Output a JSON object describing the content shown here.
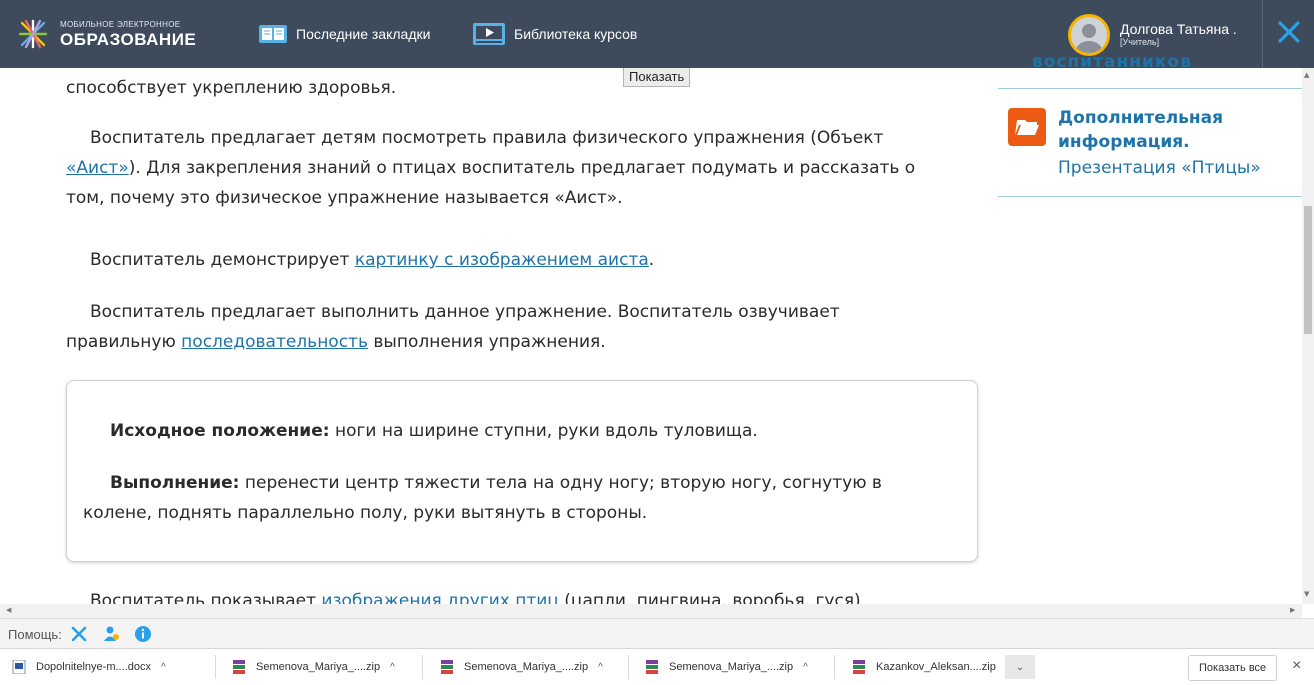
{
  "header": {
    "logo_small": "МОБИЛЬНОЕ ЭЛЕКТРОННОЕ",
    "logo_big": "ОБРАЗОВАНИЕ",
    "nav": [
      {
        "label": "Последние закладки",
        "icon": "bookmarks-icon"
      },
      {
        "label": "Библиотека курсов",
        "icon": "video-library-icon"
      }
    ],
    "user_name": "Долгова Татьяна .",
    "user_role": "[Учитель]",
    "colors": {
      "bar": "#3d4b5c",
      "accent": "#1e73a8",
      "avatar_ring": "#f5b400",
      "close": "#2aa0e8"
    }
  },
  "tooltip": "Показать",
  "content": {
    "p1": "способствует укреплению здоровья.",
    "p2_a": "Воспитатель предлагает детям посмотреть правила физического упражнения (Объект ",
    "p2_link": "«Аист»",
    "p2_b": "). Для закрепления знаний о птицах воспитатель предлагает подумать и рассказать о том, почему это физическое упражнение называется «Аист».",
    "p3_a": "Воспитатель демонстрирует ",
    "p3_link": "картинку с изображением аиста",
    "p3_b": ".",
    "p4_a": "Воспитатель предлагает выполнить данное упражнение. Воспитатель озвучивает правильную ",
    "p4_link": "последовательность",
    "p4_b": " выполнения упражнения.",
    "box": {
      "l1_bold": "Исходное положение:",
      "l1_text": " ноги на ширине ступни, руки вдоль туловища.",
      "l2_bold": "Выполнение:",
      "l2_text": " перенести центр тяжести тела на одну ногу; вторую ногу, согнутую в колене, поднять параллельно полу, руки вытянуть в стороны."
    },
    "p5_a": "Воспитатель показывает ",
    "p5_link": "изображения других птиц",
    "p5_b": " (цапли, пингвина, воробья, гуся)"
  },
  "sidebar": {
    "cut_text": "воспитанников",
    "info_title": "Дополнительная информация.",
    "info_link": "Презентация «Птицы»"
  },
  "helpbar": {
    "label": "Помощь:",
    "icons": [
      "tools-icon",
      "user-help-icon",
      "info-icon"
    ]
  },
  "downloads": {
    "items": [
      {
        "name": "Dopolnitelnye-m....docx",
        "type": "docx"
      },
      {
        "name": "Semenova_Mariya_....zip",
        "type": "zip"
      },
      {
        "name": "Semenova_Mariya_....zip",
        "type": "zip"
      },
      {
        "name": "Semenova_Mariya_....zip",
        "type": "zip"
      },
      {
        "name": "Kazankov_Aleksan....zip",
        "type": "zip"
      }
    ],
    "show_all": "Показать все"
  }
}
